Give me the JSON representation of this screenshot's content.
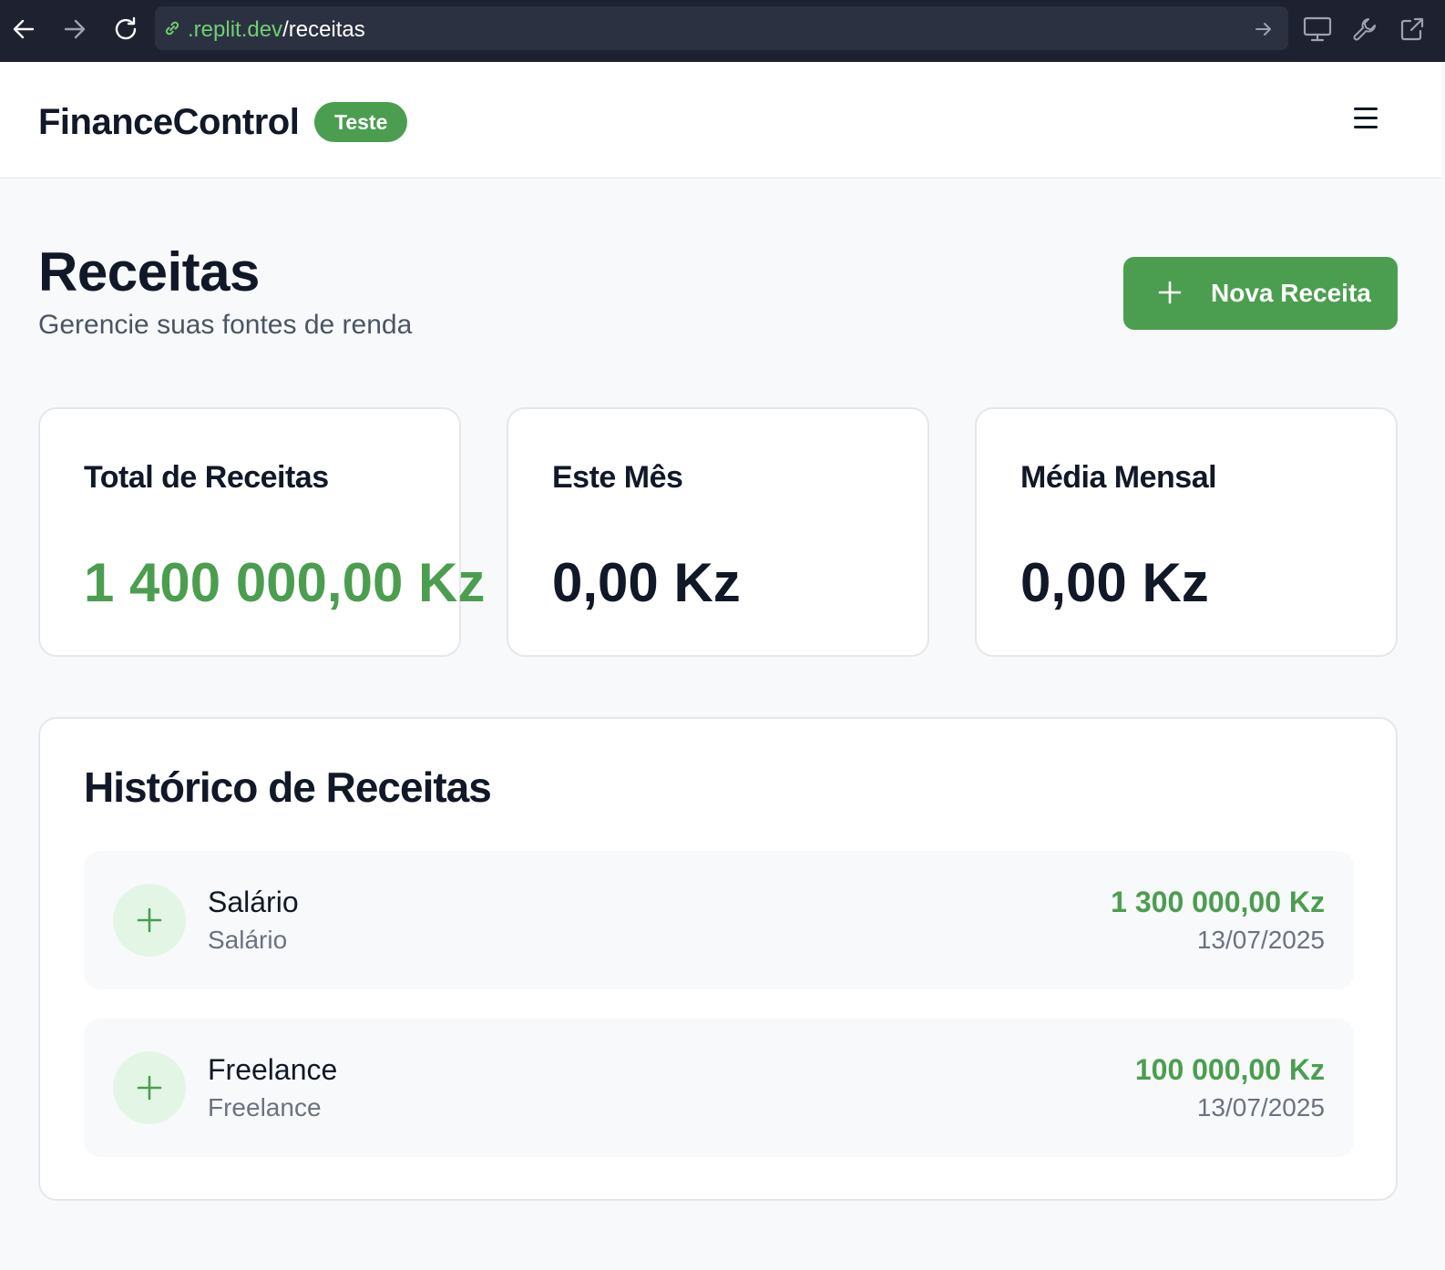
{
  "browser": {
    "url_domain": ".replit.dev",
    "url_path": "/receitas"
  },
  "header": {
    "brand": "FinanceControl",
    "badge": "Teste"
  },
  "page": {
    "title": "Receitas",
    "subtitle": "Gerencie suas fontes de renda",
    "new_button_label": "Nova Receita"
  },
  "stats": [
    {
      "label": "Total de Receitas",
      "value": "1 400 000,00 Kz"
    },
    {
      "label": "Este Mês",
      "value": "0,00 Kz"
    },
    {
      "label": "Média Mensal",
      "value": "0,00 Kz"
    }
  ],
  "history": {
    "title": "Histórico de Receitas",
    "items": [
      {
        "name": "Salário",
        "category": "Salário",
        "amount": "1 300 000,00 Kz",
        "date": "13/07/2025"
      },
      {
        "name": "Freelance",
        "category": "Freelance",
        "amount": "100 000,00 Kz",
        "date": "13/07/2025"
      }
    ]
  },
  "colors": {
    "accent": "#4b9e4f",
    "accent_light": "#e3f6e6",
    "browser_bar": "#1e2230"
  }
}
